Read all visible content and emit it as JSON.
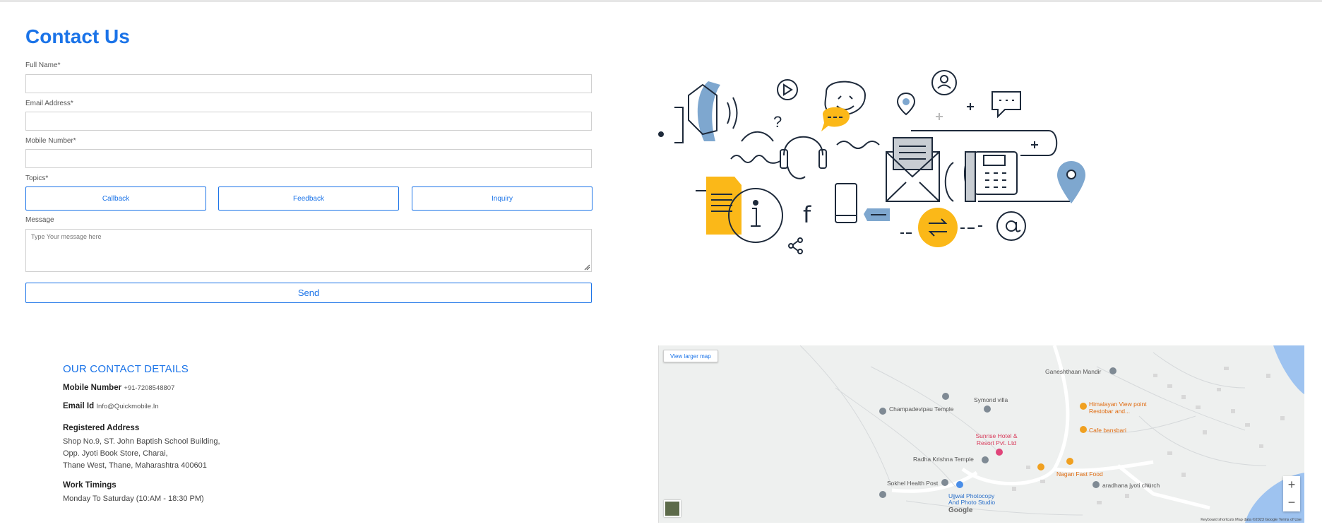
{
  "page": {
    "title": "Contact Us"
  },
  "form": {
    "full_name_label": "Full Name*",
    "email_label": "Email Address*",
    "mobile_label": "Mobile Number*",
    "topics_label": "Topics*",
    "topics": [
      "Callback",
      "Feedback",
      "Inquiry"
    ],
    "message_label": "Message",
    "message_placeholder": "Type Your message here",
    "send_label": "Send"
  },
  "contact": {
    "heading": "OUR CONTACT DETAILS",
    "mobile_label": "Mobile Number",
    "mobile_value": "+91-7208548807",
    "email_label": "Email Id",
    "email_value": "Info@Quickmobile.In",
    "address_label": "Registered Address",
    "address_lines": [
      "Shop No.9, ST. John Baptish School Building,",
      "Opp. Jyoti Book Store, Charai,",
      "Thane West, Thane, Maharashtra 400601"
    ],
    "timings_label": "Work Timings",
    "timings_value": "Monday To Saturday (10:AM - 18:30 PM)"
  },
  "map": {
    "larger_map_label": "View larger map",
    "places": {
      "ganeshthaan": "Ganeshthaan Mandir",
      "symond": "Symond villa",
      "champadevi": "Champadevipau Temple",
      "himalayan": "Himalayan View point Restobar and...",
      "cafe": "Cafe bansbari",
      "sunrise": "Sunrise Hotel & Resort Pvt. Ltd",
      "radha": "Radha Krishna Temple",
      "nagan": "Nagan Fast Food",
      "sokhel": "Sokhel Health Post",
      "ujjwal": "Ujjwal Photocopy And Photo Studio",
      "church": "aradhana jyoti church"
    },
    "google": "Google",
    "footer": "Keyboard shortcuts    Map data ©2023 Google    Terms of Use",
    "zoom_in": "+",
    "zoom_out": "−"
  },
  "icons": {
    "pin_gray": "map-pin-icon",
    "pin_orange": "restaurant-pin-icon",
    "pin_pink": "hotel-pin-icon",
    "pin_blue": "shop-pin-icon"
  },
  "colors": {
    "accent": "#1a73e8",
    "yellow": "#fbb818",
    "steel": "#7ea7cf",
    "navy": "#1e2a3b"
  }
}
